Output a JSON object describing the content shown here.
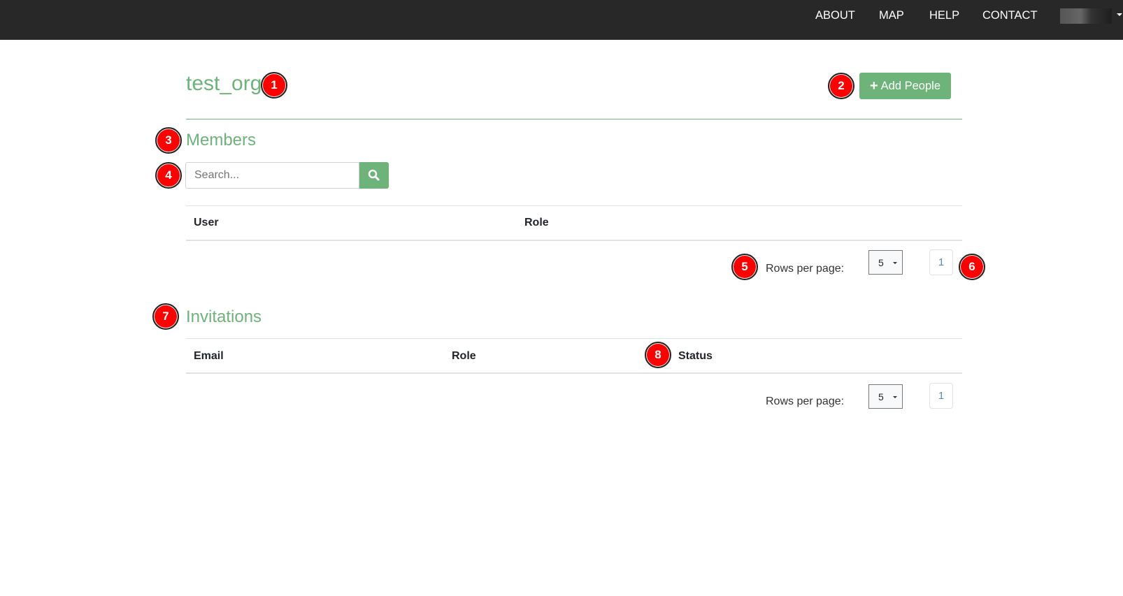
{
  "nav": {
    "items": [
      "ABOUT",
      "MAP",
      "HELP",
      "CONTACT"
    ]
  },
  "org": {
    "title": "test_org",
    "add_people_label": "Add People"
  },
  "members": {
    "heading": "Members",
    "search_placeholder": "Search...",
    "columns": [
      "User",
      "Role"
    ],
    "rows_per_page_label": "Rows per page:",
    "rows_per_page": "5",
    "page": "1"
  },
  "invitations": {
    "heading": "Invitations",
    "columns": [
      "Email",
      "Role",
      "Status"
    ],
    "rows_per_page_label": "Rows per page:",
    "rows_per_page": "5",
    "page": "1"
  },
  "markers": [
    "1",
    "2",
    "3",
    "4",
    "5",
    "6",
    "7",
    "8"
  ],
  "colors": {
    "accent": "#6db37a",
    "navbar": "#282828",
    "marker": "#ff0000"
  }
}
